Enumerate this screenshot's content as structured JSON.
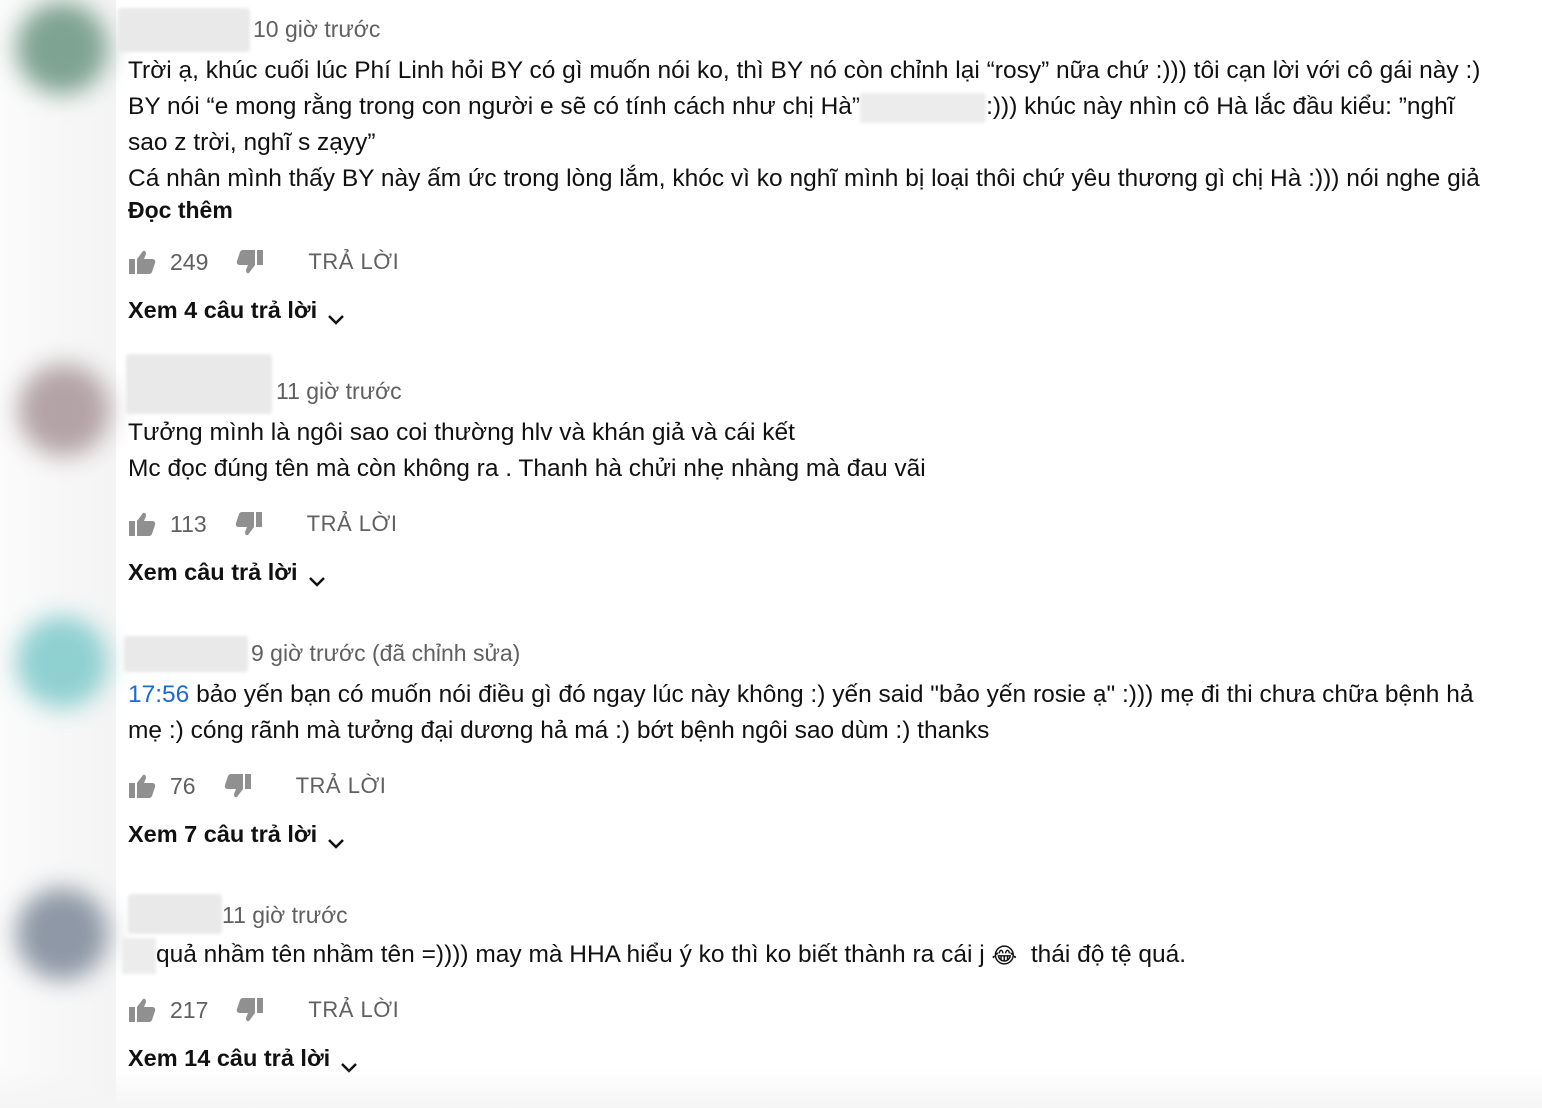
{
  "comments": [
    {
      "time": "10 giờ trước",
      "lines": [
        "Trời ạ, khúc cuối lúc Phí Linh hỏi BY có gì muốn nói ko, thì BY nó còn chỉnh lại “rosy” nữa chứ :))) tôi cạn lời với cô gái này :)",
        "sao z trời, nghĩ s zạyy”",
        "Cá nhân mình thấy BY này ấm ức trong lòng lắm, khóc vì ko nghĩ mình bị loại thôi chứ yêu thương gì chị Hà :))) nói nghe giả"
      ],
      "line2_before": "BY nói “e mong rằng trong con người e sẽ có tính cách như chị Hà”",
      "line2_after": ":))) khúc này nhìn cô Hà lắc đầu kiểu: ”nghĩ",
      "read_more": "Đọc thêm",
      "likes": "249",
      "reply_label": "TRẢ LỜI",
      "view_replies": "Xem 4 câu trả lời"
    },
    {
      "time": "11 giờ trước",
      "lines": [
        "Tưởng mình là ngôi sao coi thường hlv và khán giả và cái kết",
        "Mc đọc đúng tên mà còn không ra . Thanh hà chửi nhẹ nhàng mà đau vãi"
      ],
      "likes": "113",
      "reply_label": "TRẢ LỜI",
      "view_replies": "Xem câu trả lời"
    },
    {
      "time": "9 giờ trước (đã chỉnh sửa)",
      "timestamp_link": "17:56",
      "line1_rest": " bảo yến bạn có muốn nói điều gì đó ngay lúc này không :) yến said \"bảo yến rosie ạ\" :))) mẹ đi thi chưa chữa bệnh hả",
      "line2": "mẹ :) cóng rãnh mà tưởng đại dương hả má :) bớt bệnh ngôi sao dùm :) thanks",
      "likes": "76",
      "reply_label": "TRẢ LỜI",
      "view_replies": "Xem 7 câu trả lời"
    },
    {
      "time": "11 giờ trước",
      "text_before_emoji": "quả nhầm tên nhầm tên =)))) may mà HHA hiểu ý ko thì ko biết thành ra cái j",
      "emoji": "😂",
      "text_after_emoji": "thái độ tệ quá.",
      "likes": "217",
      "reply_label": "TRẢ LỜI",
      "view_replies": "Xem 14 câu trả lời"
    }
  ],
  "icons": {
    "like": "thumbs-up-icon",
    "dislike": "thumbs-down-icon",
    "expand": "chevron-down-icon"
  },
  "colors": {
    "timestamp_link": "#1a6ad8",
    "secondary_text": "#606060",
    "avatar_1": "#7fa392",
    "avatar_2": "#b3a3a6",
    "avatar_3": "#8fd0d1",
    "avatar_4": "#8e98a6"
  }
}
